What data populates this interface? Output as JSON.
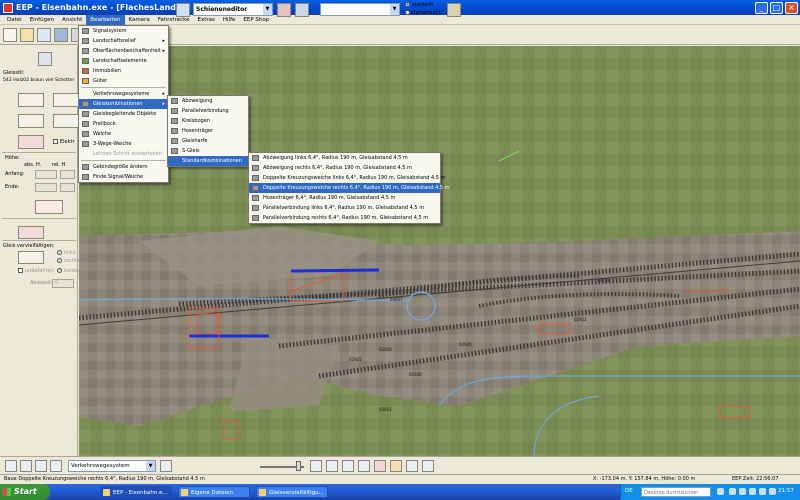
{
  "window": {
    "title": "EEP - Eisenbahn.exe - [FlachesLand11]",
    "min": "_",
    "max": "□",
    "close": "×"
  },
  "menubar": [
    "Datei",
    "Einfügen",
    "Ansicht",
    "Bearbeiten",
    "Kamera",
    "Fahrstrecke",
    "Extras",
    "Hilfe",
    "EEP Shop"
  ],
  "toolbar": {
    "editor_combo": "Schieneneditor",
    "mode_radio_1": "statisch",
    "mode_radio_2": "dynamisch"
  },
  "leftpanel": {
    "gleisstil_label": "Gleisstil:",
    "gleisstil_value": "542 Holz02 braun viel Schotter",
    "elektr_label": "Elektr",
    "hoehe_label": "Höhe:",
    "abs_label": "abs. H.",
    "rel_label": "rel. H.",
    "anfang_label": "Anfang:",
    "ende_label": "Ende:",
    "gleis_verv_label": "Gleis vervielfältigen:",
    "opt_links": "links",
    "opt_rechts": "rechts",
    "opt_unbefahren": "unbefahren",
    "opt_beidseitig": "beidseitig",
    "abstand_label": "Abstand:",
    "abstand_value": "0"
  },
  "menu_bearbeiten": {
    "items": [
      {
        "label": "Signalsystem",
        "sub": false,
        "disabled": false
      },
      {
        "label": "Landschaftsrelief",
        "sub": true,
        "disabled": false
      },
      {
        "label": "Oberflächenbeschaffenheit",
        "sub": true,
        "disabled": false
      },
      {
        "label": "Landschaftselemente",
        "sub": false,
        "disabled": false
      },
      {
        "label": "Immobilien",
        "sub": false,
        "disabled": false
      },
      {
        "label": "Güter",
        "sub": false,
        "disabled": false
      },
      {
        "label": "Verkehrswegesysteme",
        "sub": true,
        "disabled": false
      },
      {
        "label": "Gleiskombinationen",
        "sub": true,
        "disabled": false,
        "highlight": true
      },
      {
        "label": "Gleisbegleitende Objekte",
        "sub": false,
        "disabled": false
      },
      {
        "label": "Prellbock",
        "sub": false,
        "disabled": false
      },
      {
        "label": "Weiche",
        "sub": false,
        "disabled": false
      },
      {
        "label": "3-Wege-Weiche",
        "sub": false,
        "disabled": false
      },
      {
        "label": "Letzten Schritt wiederholen",
        "sub": false,
        "disabled": true
      },
      {
        "label": "Gebindegröße ändern",
        "sub": false,
        "disabled": false
      },
      {
        "label": "Finde Signal/Weiche",
        "sub": false,
        "disabled": false
      }
    ]
  },
  "menu_gleiskombinationen": {
    "items": [
      "Abzweigung",
      "Parallelverbindung",
      "Kreisbogen",
      "Hosenträger",
      "Gleisharfe",
      "S-Gleis",
      "Standardkombinationen"
    ]
  },
  "menu_standardkombinationen": {
    "items": [
      "Abzweigung links 6,4°, Radius 190 m, Gleisabstand 4,5 m",
      "Abzweigung rechts 6,4°, Radius 190 m, Gleisabstand 4,5 m",
      "Doppelte Kreuzungsweiche links 6,4°, Radius 190 m, Gleisabstand 4,5 m",
      "Doppelte Kreuzungsweiche rechts 6,4°, Radius 190 m, Gleisabstand 4,5 m",
      "Hosenträger 6,4°, Radius 190 m, Gleisabstand 4,5 m",
      "Parallelverbindung links 6,4°, Radius 190 m, Gleisabstand 4,5 m",
      "Parallelverbindung rechts 6,4°, Radius 190 m, Gleisabstand 4,5 m"
    ]
  },
  "bottombar": {
    "system_combo": "Verkehrswegesystem"
  },
  "statusbar": {
    "message": "Baue Doppelte Kreuzungsweiche rechts 6,4°, Radius 190 m, Gleisabstand 4,5 m",
    "coords": "X: -173.04 m, Y: 157.84 m, Höhe: 0.00 m",
    "time": "EEP Zeit: 22:56:07"
  },
  "taskbar": {
    "start": "Start",
    "tasks": [
      "EEP - Eisenbahn.e...",
      "Eigene Dateien",
      "Gleisvervielfältigu..."
    ],
    "lang": "DE",
    "search_placeholder": "Desktop durchsuchen",
    "clock": "21:57"
  },
  "canvas_labels": [
    "03017",
    "03018",
    "02925",
    "02928",
    "02930",
    "02926",
    "02922",
    "02921"
  ],
  "colors": {
    "menu_highlight": "#316ac5",
    "terrain_green": "#7a8a53",
    "terrain_gray": "#8c8578",
    "track_blue": "#1b2fd8",
    "object_red": "#e05a3a"
  }
}
